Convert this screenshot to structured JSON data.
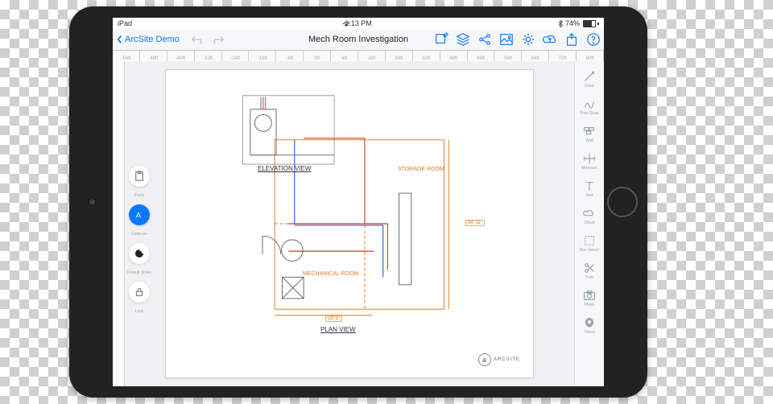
{
  "status": {
    "device": "iPad",
    "time": "2:13 PM",
    "bluetooth": "bt-icon",
    "battery_text": "74%"
  },
  "toolbar": {
    "back_label": "ArcSite Demo",
    "doc_title": "Mech Room Investigation",
    "icons": [
      "edit",
      "layers",
      "share-nodes",
      "image",
      "settings",
      "cloud-up",
      "export",
      "help"
    ]
  },
  "ruler_ticks": [
    "-56ft",
    "-48ft",
    "-40ft",
    "-32ft",
    "-24ft",
    "-16ft",
    "-8ft",
    "0ft",
    "8ft",
    "16ft",
    "24ft",
    "32ft",
    "40ft",
    "48ft",
    "56ft",
    "64ft",
    "72ft",
    "80ft"
  ],
  "left_palette": [
    {
      "name": "paste",
      "label": "Paste"
    },
    {
      "name": "calibrate",
      "label": "Calibrate",
      "active": true
    },
    {
      "name": "default-styles",
      "label": "Default Styles"
    },
    {
      "name": "lock",
      "label": "Lock"
    }
  ],
  "right_bar": [
    {
      "name": "draw",
      "label": "Draw"
    },
    {
      "name": "free-draw",
      "label": "Free Draw"
    },
    {
      "name": "wall",
      "label": "Wall"
    },
    {
      "name": "measure",
      "label": "Measure"
    },
    {
      "name": "text",
      "label": "Text"
    },
    {
      "name": "cloud",
      "label": "Cloud"
    },
    {
      "name": "box-select",
      "label": "Box Select"
    },
    {
      "name": "trim",
      "label": "Trim"
    },
    {
      "name": "photo",
      "label": "Photo"
    },
    {
      "name": "visual",
      "label": "Visual"
    }
  ],
  "drawing": {
    "elevation_label": "ELEVATION VIEW",
    "plan_label": "PLAN VIEW",
    "room_storage": "STORAGE ROOM",
    "room_mech": "MECHANICAL ROOM",
    "dim_right": "34' 11\"",
    "dim_bottom": "29' 5\"",
    "brand": "ARCSITE"
  }
}
